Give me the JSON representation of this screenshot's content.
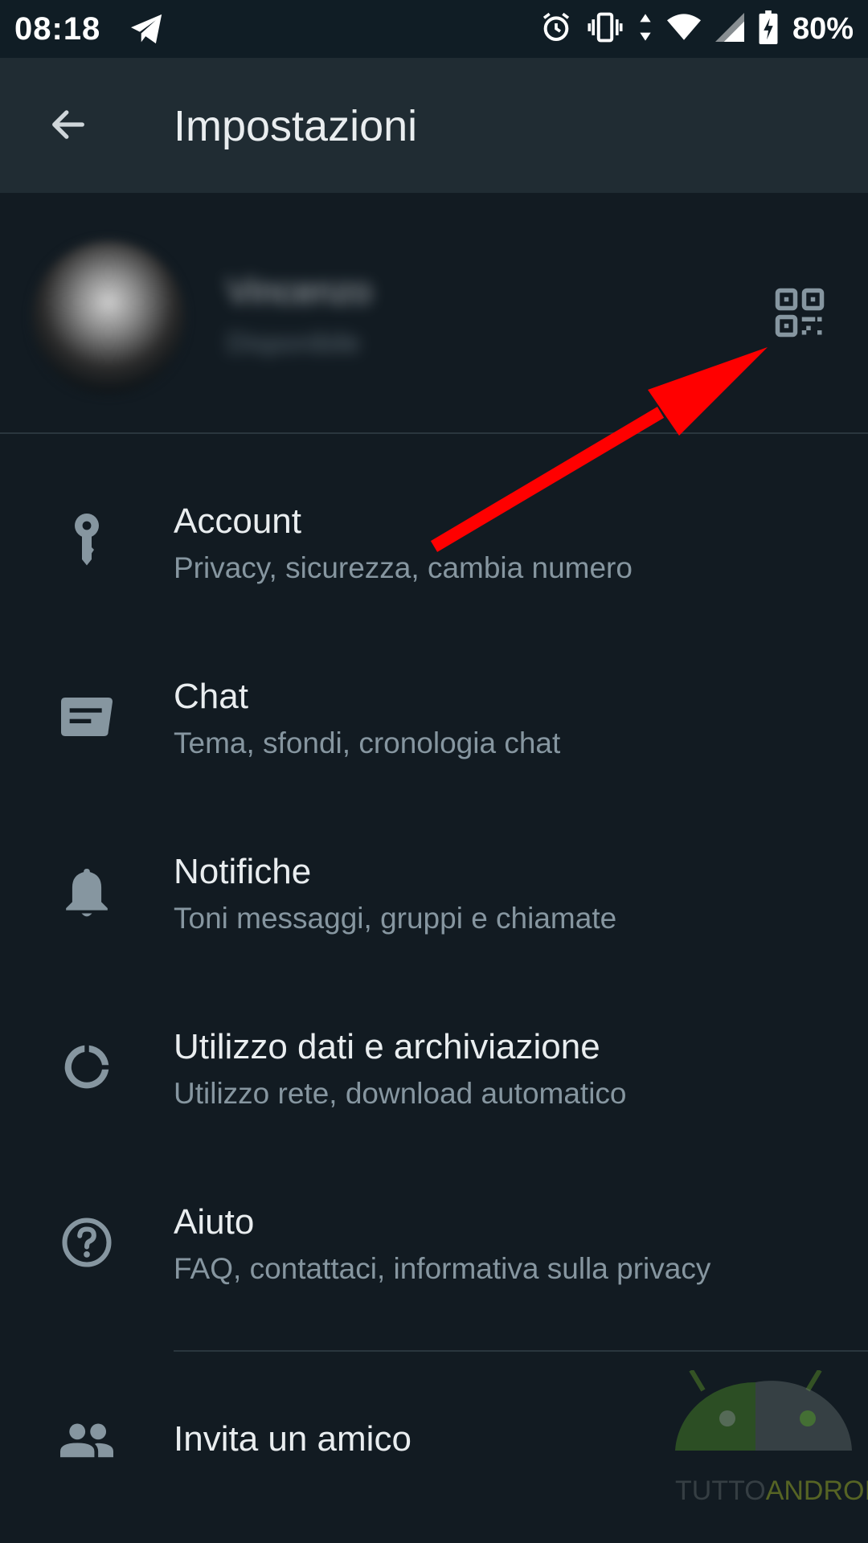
{
  "status_bar": {
    "time": "08:18",
    "battery": "80%",
    "icons": [
      "telegram-icon",
      "alarm-icon",
      "vibrate-icon",
      "data-arrows-icon",
      "wifi-icon",
      "signal-icon",
      "battery-charging-icon"
    ]
  },
  "app_bar": {
    "title": "Impostazioni",
    "back_icon": "arrow-back-icon"
  },
  "profile": {
    "name": "Vincenzo",
    "status": "Disponibile",
    "qr_icon": "qr-code-icon"
  },
  "settings": [
    {
      "label": "Account",
      "sub": "Privacy, sicurezza, cambia numero",
      "icon": "key-icon"
    },
    {
      "label": "Chat",
      "sub": "Tema, sfondi, cronologia chat",
      "icon": "chat-icon"
    },
    {
      "label": "Notifiche",
      "sub": "Toni messaggi, gruppi e chiamate",
      "icon": "bell-icon"
    },
    {
      "label": "Utilizzo dati e archiviazione",
      "sub": "Utilizzo rete, download automatico",
      "icon": "data-usage-icon"
    },
    {
      "label": "Aiuto",
      "sub": "FAQ, contattaci, informativa sulla privacy",
      "icon": "help-icon"
    }
  ],
  "invite": {
    "label": "Invita un amico",
    "icon": "people-icon"
  },
  "watermark": {
    "part1": "TUTTO",
    "part2": "ANDROID"
  },
  "colors": {
    "background": "#121b22",
    "app_bar": "#202c33",
    "primary_text": "#e9edef",
    "secondary_text": "#8696a0",
    "icon": "#8696a0",
    "annotation_arrow": "#ff0000"
  }
}
